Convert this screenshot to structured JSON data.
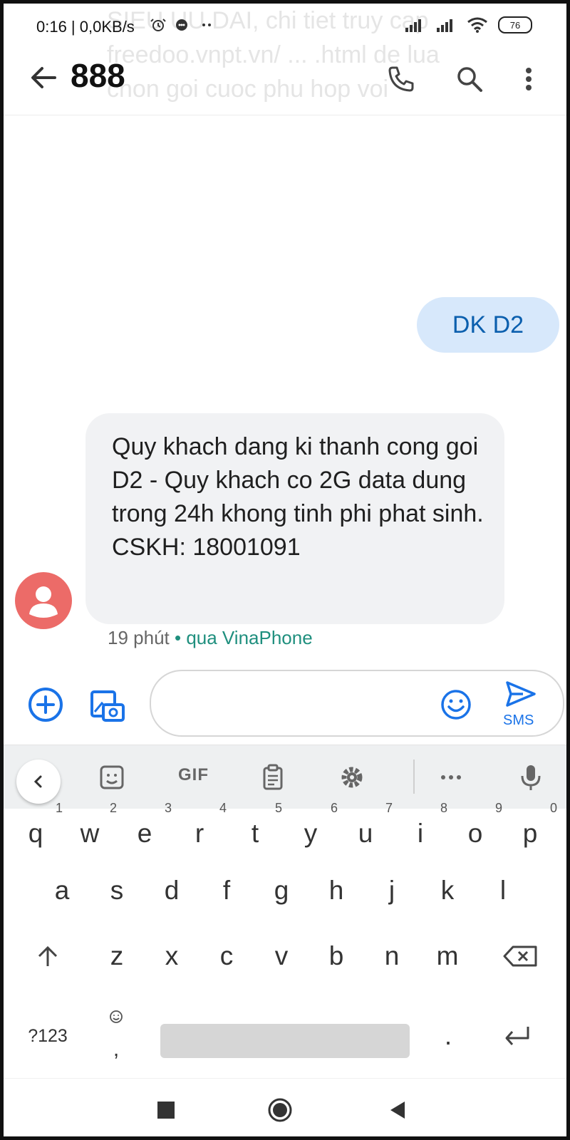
{
  "status_bar": {
    "time": "0:16 | 0,0KB/s",
    "battery": "76"
  },
  "ghost_text": "SIEU UU DAI, chi tiet truy cap freedoo.vnpt.vn/ ... .html de lua chon goi cuoc phu hop voi",
  "app_bar": {
    "title": "888"
  },
  "messages": {
    "sent": {
      "text": "DK D2"
    },
    "received": {
      "text": "Quy khach dang ki thanh cong goi D2 - Quy khach co 2G data dung trong 24h khong tinh phi phat sinh. CSKH: 18001091",
      "time": "19 phút",
      "separator": "•",
      "via": "qua VinaPhone"
    }
  },
  "composer": {
    "send_label": "SMS"
  },
  "keyboard": {
    "toolbar": {
      "gif_label": "GIF"
    },
    "rows": {
      "r1": [
        "q",
        "w",
        "e",
        "r",
        "t",
        "y",
        "u",
        "i",
        "o",
        "p"
      ],
      "r1_numbers": [
        "1",
        "2",
        "3",
        "4",
        "5",
        "6",
        "7",
        "8",
        "9",
        "0"
      ],
      "r2": [
        "a",
        "s",
        "d",
        "f",
        "g",
        "h",
        "j",
        "k",
        "l"
      ],
      "r3": [
        "z",
        "x",
        "c",
        "v",
        "b",
        "n",
        "m"
      ],
      "r4": {
        "mode": "?123",
        "comma": ",",
        "dot": "."
      }
    }
  },
  "colors": {
    "accent": "#1a73e8",
    "sent_bubble": "#d7e8fb",
    "received_bubble": "#f1f2f4",
    "avatar": "#ec6b68",
    "via_text": "#1f8f7e"
  },
  "icons": {
    "status": [
      "alarm-icon",
      "notification-icon",
      "more-dots-icon",
      "signal-icon",
      "wifi-icon"
    ],
    "header": [
      "back-arrow-icon",
      "phone-icon",
      "search-icon",
      "more-vert-icon"
    ]
  }
}
